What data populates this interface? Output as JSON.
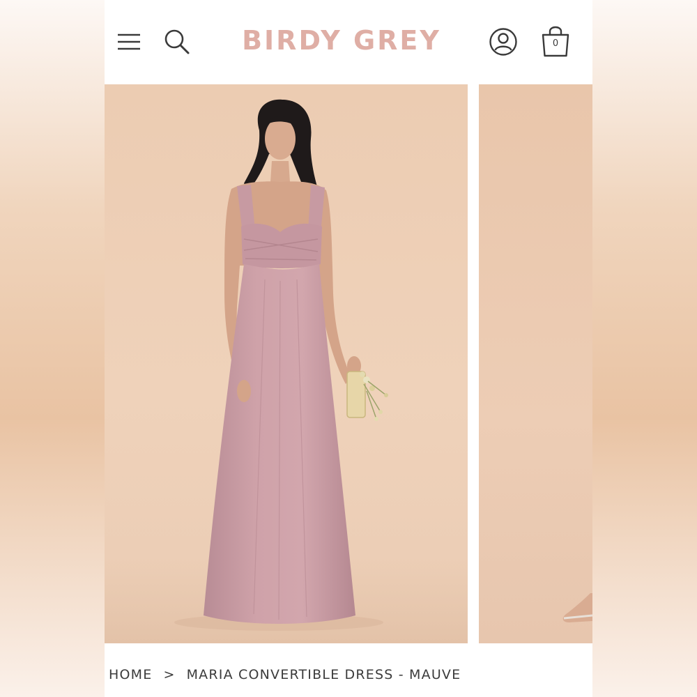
{
  "brand": {
    "logo_text": "BIRDY GREY",
    "logo_color": "#dfaea5"
  },
  "header": {
    "menu_icon": "hamburger-menu-icon",
    "search_icon": "search-icon",
    "account_icon": "user-account-icon",
    "cart_icon": "shopping-bag-icon",
    "cart_count": "0"
  },
  "gallery": {
    "slides": [
      {
        "subject": "model in mauve convertible dress",
        "dress_color": "#c89ba3",
        "background": "#edcfb6"
      },
      {
        "subject": "partial next product image",
        "background": "#ebcab0"
      }
    ]
  },
  "breadcrumb": {
    "home": "HOME",
    "separator": ">",
    "current": "MARIA CONVERTIBLE DRESS - MAUVE"
  }
}
